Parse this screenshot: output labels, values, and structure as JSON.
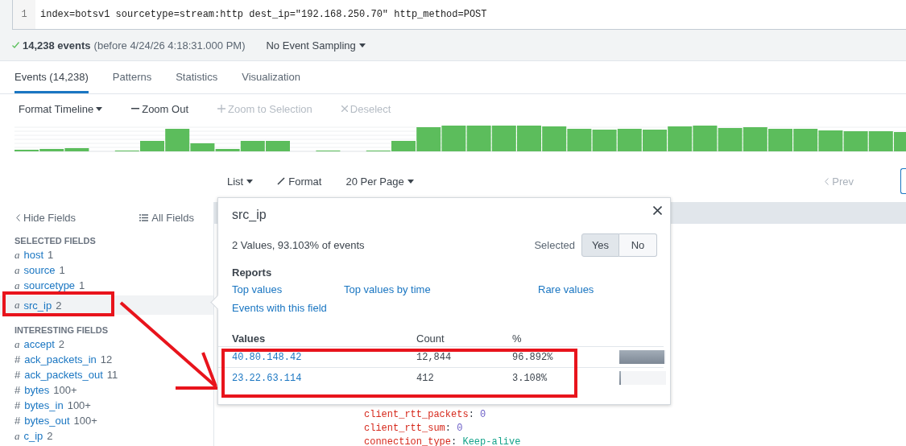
{
  "search": {
    "line_number": "1",
    "query": "index=botsv1 sourcetype=stream:http dest_ip=\"192.168.250.70\" http_method=POST"
  },
  "status": {
    "count": "14,238 events",
    "range": "(before 4/24/26 4:18:31.000 PM)",
    "sampling": "No Event Sampling"
  },
  "tabs": [
    {
      "label": "Events (14,238)",
      "selected": true
    },
    {
      "label": "Patterns",
      "selected": false
    },
    {
      "label": "Statistics",
      "selected": false
    },
    {
      "label": "Visualization",
      "selected": false
    }
  ],
  "timeline_toolbar": [
    {
      "kind": "dropdown",
      "label": "Format Timeline",
      "disabled": false
    },
    {
      "kind": "minus",
      "label": "Zoom Out",
      "disabled": false
    },
    {
      "kind": "plus",
      "label": "Zoom to Selection",
      "disabled": true
    },
    {
      "kind": "times",
      "label": "Deselect",
      "disabled": true
    }
  ],
  "results_toolbar": [
    {
      "kind": "dropdown",
      "label": "List"
    },
    {
      "kind": "pencil",
      "label": "Format"
    },
    {
      "kind": "dropdown",
      "label": "20 Per Page"
    }
  ],
  "pagination": {
    "prev": "Prev"
  },
  "sidebar": {
    "hide_fields": "Hide Fields",
    "all_fields": "All Fields",
    "sections": [
      {
        "title": "SELECTED FIELDS",
        "fields": [
          {
            "type": "a",
            "name": "host",
            "count": "1",
            "highlighted": false
          },
          {
            "type": "a",
            "name": "source",
            "count": "1",
            "highlighted": false
          },
          {
            "type": "a",
            "name": "sourcetype",
            "count": "1",
            "highlighted": false
          },
          {
            "type": "a",
            "name": "src_ip",
            "count": "2",
            "highlighted": true
          }
        ]
      },
      {
        "title": "INTERESTING FIELDS",
        "fields": [
          {
            "type": "a",
            "name": "accept",
            "count": "2",
            "highlighted": false
          },
          {
            "type": "#",
            "name": "ack_packets_in",
            "count": "12",
            "highlighted": false
          },
          {
            "type": "#",
            "name": "ack_packets_out",
            "count": "11",
            "highlighted": false
          },
          {
            "type": "#",
            "name": "bytes",
            "count": "100+",
            "highlighted": false
          },
          {
            "type": "#",
            "name": "bytes_in",
            "count": "100+",
            "highlighted": false
          },
          {
            "type": "#",
            "name": "bytes_out",
            "count": "100+",
            "highlighted": false
          },
          {
            "type": "a",
            "name": "c_ip",
            "count": "2",
            "highlighted": false
          }
        ]
      }
    ]
  },
  "popup": {
    "title": "src_ip",
    "summary": "2 Values, 93.103% of events",
    "selected_label": "Selected",
    "selected_options": [
      {
        "label": "Yes",
        "selected": true
      },
      {
        "label": "No",
        "selected": false
      }
    ],
    "reports_title": "Reports",
    "reports": [
      "Top values",
      "Top values by time",
      "Rare values",
      "Events with this field"
    ],
    "columns": [
      "Values",
      "Count",
      "%"
    ],
    "values": [
      {
        "value": "40.80.148.42",
        "count": "12,844",
        "percent": "96.892%",
        "level": 0.96892
      },
      {
        "value": "23.22.63.114",
        "count": "412",
        "percent": "3.108%",
        "level": 0.03108
      }
    ]
  },
  "event_lines": [
    {
      "key": "client_rtt_packets",
      "separator": ":",
      "value": "0",
      "kind": "number"
    },
    {
      "key": "client_rtt_sum",
      "separator": ":",
      "value": "0",
      "kind": "number"
    },
    {
      "key": "connection_type",
      "separator": ":",
      "value": "Keep-alive",
      "kind": "string"
    }
  ]
}
